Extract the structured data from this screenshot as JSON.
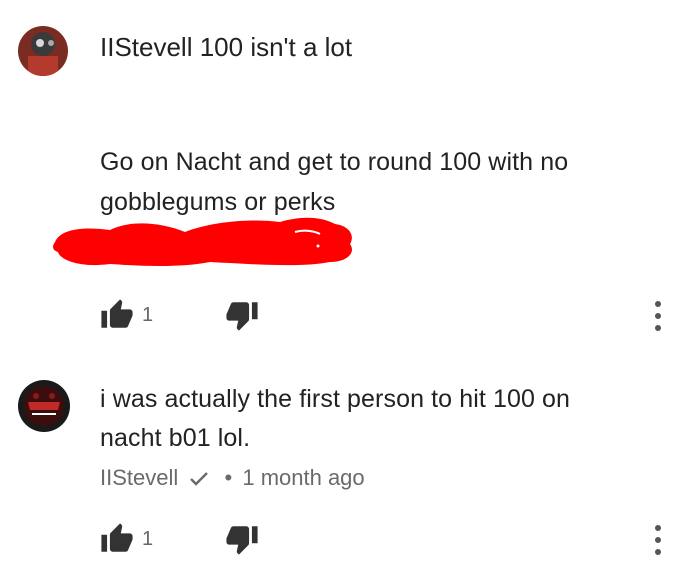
{
  "comment": {
    "header": "IIStevell 100 isn't a lot",
    "body_lines": [
      "Go on Nacht and get to round 100 with no",
      "gobblegums or perks"
    ],
    "like_count": "1",
    "icons": {
      "avatar": "avatar-icon",
      "like": "thumbs-up-icon",
      "dislike": "thumbs-down-icon",
      "more": "more-vert-icon"
    }
  },
  "reply": {
    "body_lines": [
      "i was actually the first person to hit 100 on",
      "nacht b01 lol."
    ],
    "author": "IIStevell",
    "separator": "•",
    "timestamp": "1 month ago",
    "like_count": "1",
    "verified": true
  },
  "colors": {
    "text": "#222222",
    "meta": "#6a6a6a",
    "icon": "#333333",
    "redaction": "#ff0000"
  }
}
